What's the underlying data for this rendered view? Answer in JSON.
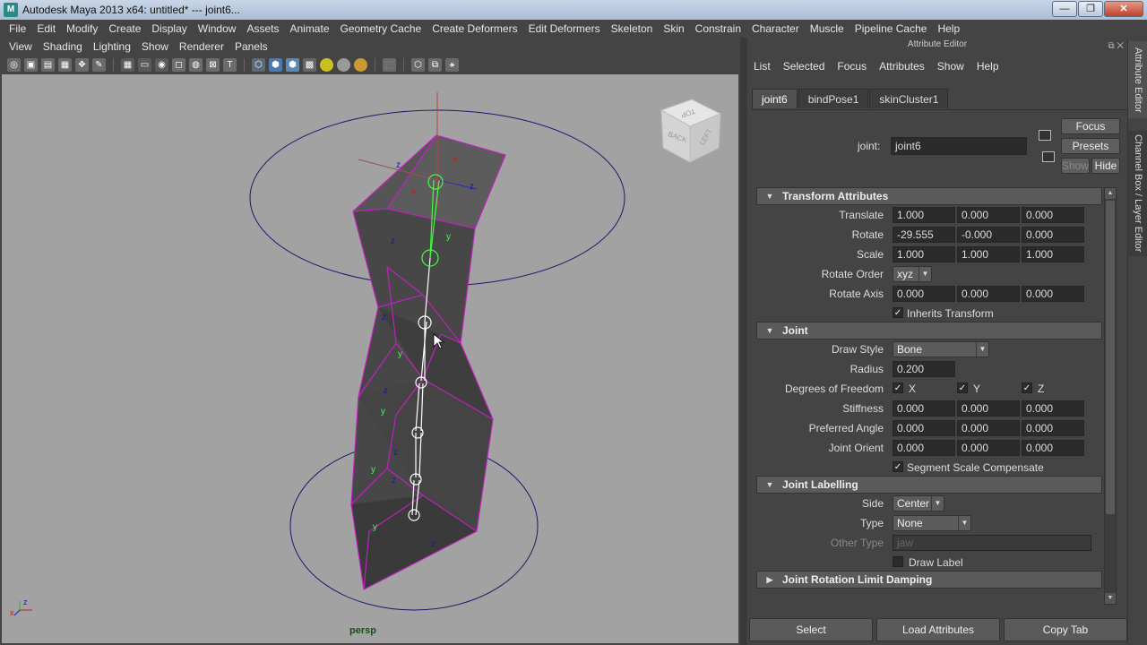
{
  "window": {
    "title": "Autodesk Maya 2013 x64: untitled*   ---   joint6...",
    "app_icon": "maya-icon",
    "controls": {
      "minimize": "—",
      "maximize": "❐",
      "close": "✕"
    }
  },
  "main_menu": [
    "File",
    "Edit",
    "Modify",
    "Create",
    "Display",
    "Window",
    "Assets",
    "Animate",
    "Geometry Cache",
    "Create Deformers",
    "Edit Deformers",
    "Skeleton",
    "Skin",
    "Constrain",
    "Character",
    "Muscle",
    "Pipeline Cache",
    "Help"
  ],
  "viewport": {
    "menu": [
      "View",
      "Shading",
      "Lighting",
      "Show",
      "Renderer",
      "Panels"
    ],
    "camera_label": "persp",
    "viewcube_faces": {
      "top": "TOP",
      "back": "BACK",
      "left": "LEFT"
    },
    "axis_labels": {
      "x": "x",
      "y": "y",
      "z": "z"
    },
    "colors": {
      "background": "#a2a2a2",
      "mesh": "#4a4a4a",
      "wire": "#c020c0",
      "curve": "#1a1a6e",
      "bone": "#ffffff",
      "selected": "#40ff40"
    }
  },
  "attribute_editor": {
    "title": "Attribute Editor",
    "menu": [
      "List",
      "Selected",
      "Focus",
      "Attributes",
      "Show",
      "Help"
    ],
    "tabs": [
      {
        "label": "joint6",
        "active": true
      },
      {
        "label": "bindPose1",
        "active": false
      },
      {
        "label": "skinCluster1",
        "active": false
      }
    ],
    "node_label": "joint:",
    "node_name": "joint6",
    "buttons": {
      "focus": "Focus",
      "presets": "Presets",
      "show": "Show",
      "hide": "Hide"
    },
    "transform": {
      "header": "Transform Attributes",
      "translate": {
        "label": "Translate",
        "values": [
          "1.000",
          "0.000",
          "0.000"
        ]
      },
      "rotate": {
        "label": "Rotate",
        "values": [
          "-29.555",
          "-0.000",
          "0.000"
        ]
      },
      "scale": {
        "label": "Scale",
        "values": [
          "1.000",
          "1.000",
          "1.000"
        ]
      },
      "rotate_order": {
        "label": "Rotate Order",
        "value": "xyz"
      },
      "rotate_axis": {
        "label": "Rotate Axis",
        "values": [
          "0.000",
          "0.000",
          "0.000"
        ]
      },
      "inherits": {
        "label": "Inherits Transform",
        "checked": true
      }
    },
    "joint": {
      "header": "Joint",
      "draw_style": {
        "label": "Draw Style",
        "value": "Bone"
      },
      "radius": {
        "label": "Radius",
        "value": "0.200"
      },
      "dof": {
        "label": "Degrees of Freedom",
        "x": "X",
        "y": "Y",
        "z": "Z"
      },
      "stiffness": {
        "label": "Stiffness",
        "values": [
          "0.000",
          "0.000",
          "0.000"
        ]
      },
      "preferred_angle": {
        "label": "Preferred Angle",
        "values": [
          "0.000",
          "0.000",
          "0.000"
        ]
      },
      "joint_orient": {
        "label": "Joint Orient",
        "values": [
          "0.000",
          "0.000",
          "0.000"
        ]
      },
      "segment_scale": {
        "label": "Segment Scale Compensate",
        "checked": true
      }
    },
    "labelling": {
      "header": "Joint Labelling",
      "side": {
        "label": "Side",
        "value": "Center"
      },
      "type": {
        "label": "Type",
        "value": "None"
      },
      "other_type": {
        "label": "Other Type",
        "placeholder": "jaw"
      },
      "draw_label": {
        "label": "Draw Label",
        "checked": false
      }
    },
    "rotation_limit": {
      "header": "Joint Rotation Limit Damping"
    },
    "bottom_buttons": {
      "select": "Select",
      "load": "Load Attributes",
      "copy": "Copy Tab"
    }
  },
  "side_tabs": {
    "attribute_editor": "Attribute Editor",
    "channel_box": "Channel Box / Layer Editor"
  }
}
